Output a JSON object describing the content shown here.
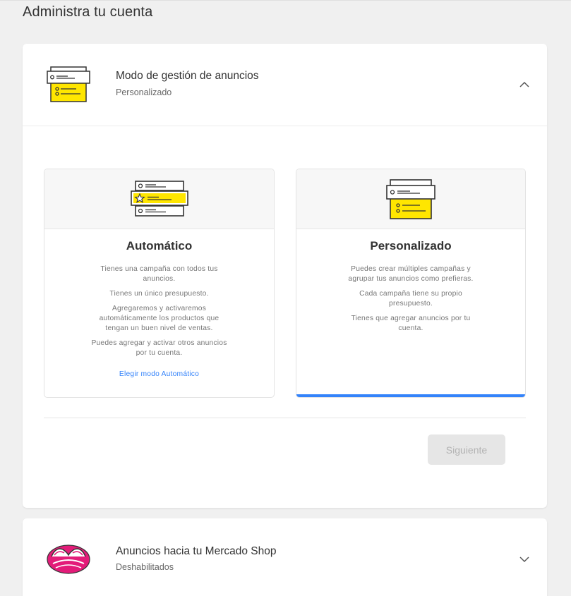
{
  "page_title": "Administra tu cuenta",
  "colors": {
    "accent": "#3483fa",
    "yellow": "#ffe600",
    "mshop_pink": "#e31c79"
  },
  "ads_mode": {
    "title": "Modo de gestión de anuncios",
    "subtitle": "Personalizado",
    "expanded": true,
    "options": [
      {
        "id": "auto",
        "title": "Automático",
        "icon": "ads-star-icon",
        "bullets": [
          "Tienes una campaña con todos tus anuncios.",
          "Tienes un único presupuesto.",
          "Agregaremos y activaremos automáticamente los productos que tengan un buen nivel de ventas.",
          "Puedes agregar y activar otros anuncios por tu cuenta."
        ],
        "link": "Elegir modo Automático"
      },
      {
        "id": "custom",
        "title": "Personalizado",
        "icon": "ads-custom-icon",
        "selected": true,
        "bullets": [
          "Puedes crear múltiples campañas y agrupar tus anuncios como prefieras.",
          "Cada campaña tiene su propio presupuesto.",
          "Tienes que agregar anuncios por tu cuenta."
        ]
      }
    ],
    "next_button": "Siguiente"
  },
  "mshop": {
    "title": "Anuncios hacia tu Mercado Shop",
    "subtitle": "Deshabilitados",
    "expanded": false
  }
}
